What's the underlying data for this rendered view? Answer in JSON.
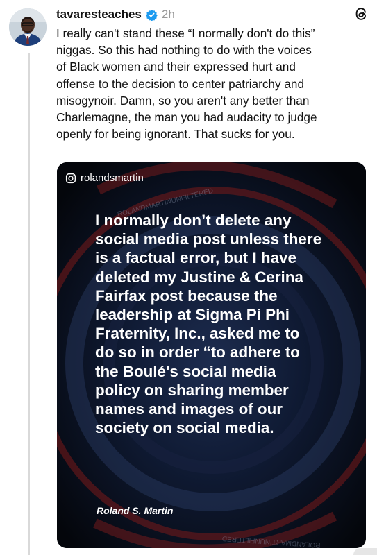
{
  "post": {
    "username": "tavaresteaches",
    "time": "2h",
    "text": "I really can't stand these “I normally don't do this”\nniggas.  So this had nothing to do with the voices\nof Black women and their expressed hurt and\noffense to the decision to center patriarchy and\nmisogynoir. Damn, so you aren't any better than\nCharlemagne, the man you had audacity to judge\nopenly for being ignorant. That sucks for you."
  },
  "media": {
    "instagram_handle": "rolandsmartin",
    "watermark_text": "ROLANDMARTINUNFILTERED",
    "quote": "I normally don’t delete any\nsocial media post unless there\nis a factual error, but I have\ndeleted my Justine & Cerina\nFairfax post because the\nleadership at Sigma Pi Phi\nFraternity, Inc., asked me to\ndo so in order “to adhere to\nthe Boulé's social media\npolicy on sharing member\nnames and images of our\nsociety on social media.",
    "signature": "Roland S. Martin"
  },
  "icons": {
    "verified": "verified-badge-icon",
    "threads": "threads-logo-icon",
    "instagram": "instagram-icon"
  },
  "colors": {
    "verified": "#1d9bf0",
    "text": "#121212",
    "time": "#9a9a9a",
    "media_bg": "#06080c"
  }
}
